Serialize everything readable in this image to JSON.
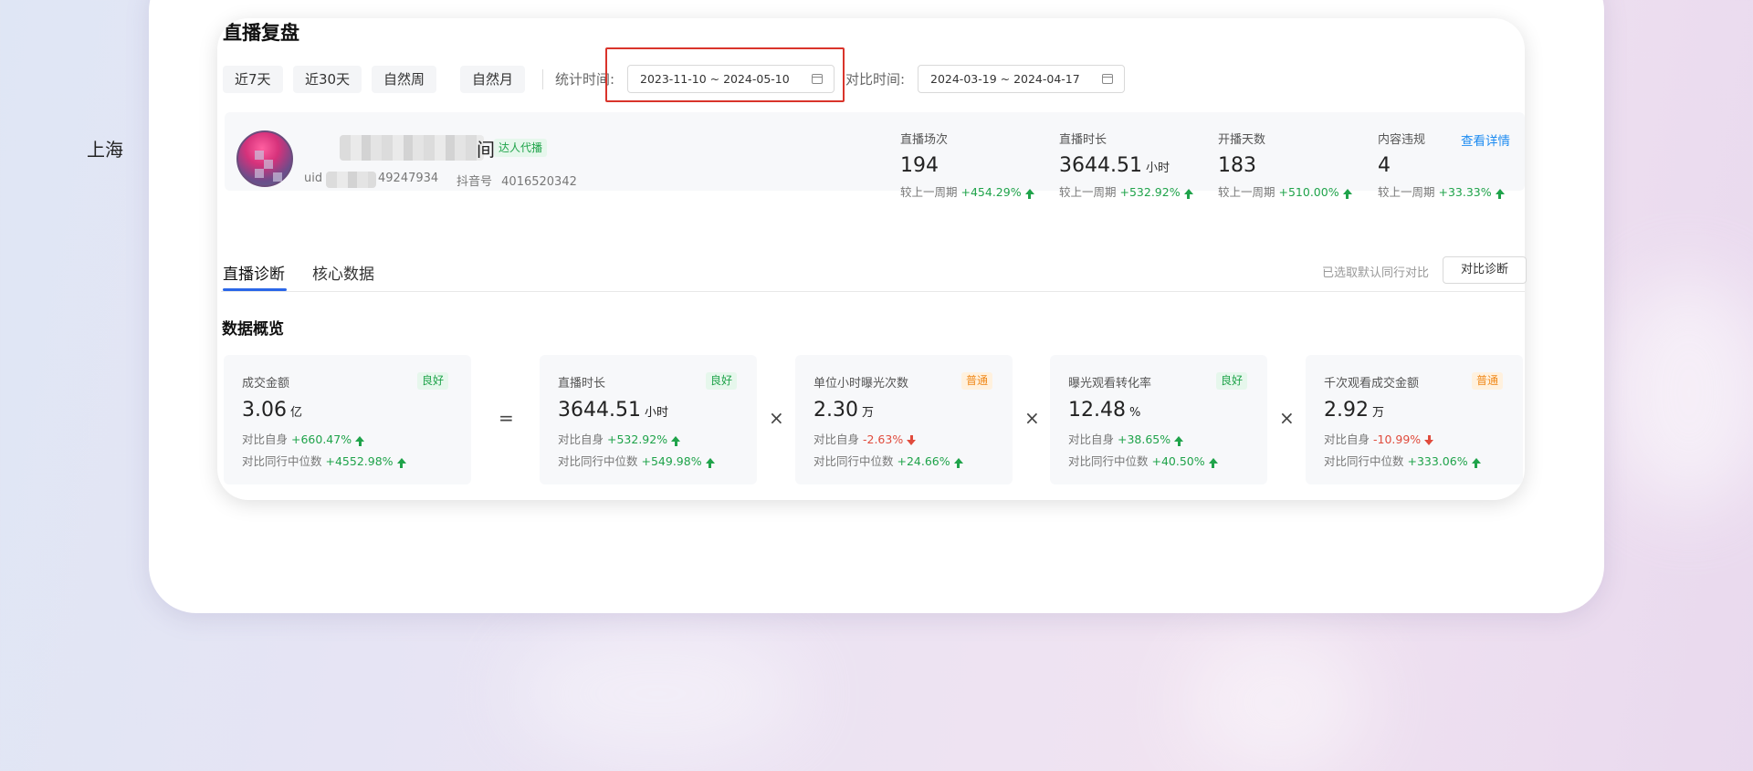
{
  "page": {
    "title": "直播复盘"
  },
  "quick_ranges": [
    "近7天",
    "近30天",
    "自然周",
    "自然月"
  ],
  "stat_time": {
    "label": "统计时间:",
    "value": "2023-11-10 ~ 2024-05-10"
  },
  "compare_time": {
    "label": "对比时间:",
    "value": "2024-03-19 ~ 2024-04-17"
  },
  "account": {
    "name_prefix": "上海",
    "name_suffix": "间",
    "tag": "达人代播",
    "uid_label": "uid",
    "uid_value": "49247934",
    "douyin_label": "抖音号",
    "douyin_value": "4016520342"
  },
  "summary_stats": [
    {
      "label": "直播场次",
      "value": "194",
      "unit": "",
      "cmp_label": "较上一周期",
      "cmp_value": "+454.29%",
      "trend": "up"
    },
    {
      "label": "直播时长",
      "value": "3644.51",
      "unit": "小时",
      "cmp_label": "较上一周期",
      "cmp_value": "+532.92%",
      "trend": "up"
    },
    {
      "label": "开播天数",
      "value": "183",
      "unit": "",
      "cmp_label": "较上一周期",
      "cmp_value": "+510.00%",
      "trend": "up"
    },
    {
      "label": "内容违规",
      "value": "4",
      "unit": "",
      "cmp_label": "较上一周期",
      "cmp_value": "+33.33%",
      "trend": "up"
    }
  ],
  "detail_link": "查看详情",
  "tabs": [
    "直播诊断",
    "核心数据"
  ],
  "peer_hint": "已选取默认同行对比",
  "peer_button": "对比诊断",
  "section_title": "数据概览",
  "metrics": [
    {
      "label": "成交金额",
      "badge": "良好",
      "badge_type": "good",
      "value": "3.06",
      "unit": "亿",
      "cmp1_label": "对比自身",
      "cmp1_value": "+660.47%",
      "cmp1_trend": "up",
      "cmp2_label": "对比同行中位数",
      "cmp2_value": "+4552.98%",
      "cmp2_trend": "up"
    },
    {
      "label": "直播时长",
      "badge": "良好",
      "badge_type": "good",
      "value": "3644.51",
      "unit": "小时",
      "cmp1_label": "对比自身",
      "cmp1_value": "+532.92%",
      "cmp1_trend": "up",
      "cmp2_label": "对比同行中位数",
      "cmp2_value": "+549.98%",
      "cmp2_trend": "up"
    },
    {
      "label": "单位小时曝光次数",
      "badge": "普通",
      "badge_type": "normal",
      "value": "2.30",
      "unit": "万",
      "cmp1_label": "对比自身",
      "cmp1_value": "-2.63%",
      "cmp1_trend": "down",
      "cmp2_label": "对比同行中位数",
      "cmp2_value": "+24.66%",
      "cmp2_trend": "up"
    },
    {
      "label": "曝光观看转化率",
      "badge": "良好",
      "badge_type": "good",
      "value": "12.48",
      "unit": "%",
      "cmp1_label": "对比自身",
      "cmp1_value": "+38.65%",
      "cmp1_trend": "up",
      "cmp2_label": "对比同行中位数",
      "cmp2_value": "+40.50%",
      "cmp2_trend": "up"
    },
    {
      "label": "千次观看成交金额",
      "badge": "普通",
      "badge_type": "normal",
      "value": "2.92",
      "unit": "万",
      "cmp1_label": "对比自身",
      "cmp1_value": "-10.99%",
      "cmp1_trend": "down",
      "cmp2_label": "对比同行中位数",
      "cmp2_value": "+333.06%",
      "cmp2_trend": "up"
    }
  ],
  "operators": [
    "=",
    "×",
    "×",
    "×"
  ]
}
